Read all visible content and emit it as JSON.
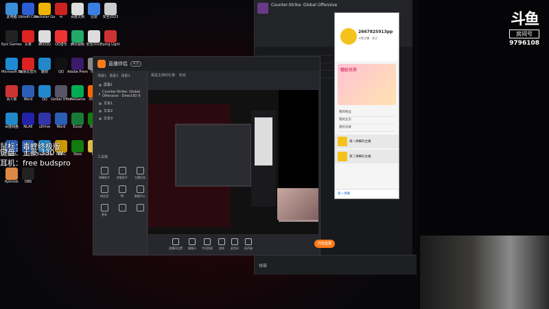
{
  "desktop": {
    "icons": [
      {
        "label": "此电脑",
        "color": "#3a8fd8"
      },
      {
        "label": "Ubisoft Connect",
        "color": "#2c5dd4"
      },
      {
        "label": "Rockstar Games",
        "color": "#f0b400"
      },
      {
        "label": "m",
        "color": "#c22"
      },
      {
        "label": "百度文档",
        "color": "#ddd"
      },
      {
        "label": "迅雷",
        "color": "#3a7fe0"
      },
      {
        "label": "安全2023",
        "color": "#ccc"
      },
      {
        "label": "Epic Games Launcher",
        "color": "#222"
      },
      {
        "label": "头条",
        "color": "#d22"
      },
      {
        "label": "腾讯QQ",
        "color": "#ddd"
      },
      {
        "label": "QQ音乐",
        "color": "#e33"
      },
      {
        "label": "腾讯视频",
        "color": "#2a6"
      },
      {
        "label": "安全2022",
        "color": "#ddd"
      },
      {
        "label": "Dying Light 2",
        "color": "#c33"
      },
      {
        "label": "Microsoft Edge",
        "color": "#1f8ad6"
      },
      {
        "label": "网易云音乐",
        "color": "#d22"
      },
      {
        "label": "酷狗",
        "color": "#28c"
      },
      {
        "label": "QQ",
        "color": "#111"
      },
      {
        "label": "Adobe Premiere",
        "color": "#3a1a6a"
      },
      {
        "label": "IMG",
        "color": "#888"
      },
      {
        "label": "Steam",
        "color": "#1a2b4a"
      },
      {
        "label": "百人斩",
        "color": "#c33"
      },
      {
        "label": "Word",
        "color": "#2a5fb5"
      },
      {
        "label": "QQ",
        "color": "#28c"
      },
      {
        "label": "Global Offensive",
        "color": "#556"
      },
      {
        "label": "WeGame",
        "color": "#0a5"
      },
      {
        "label": "Origin",
        "color": "#f60"
      },
      {
        "label": "Rockstar",
        "color": "#fa0"
      },
      {
        "label": "百度网盘",
        "color": "#28c"
      },
      {
        "label": "NLAE",
        "color": "#22a"
      },
      {
        "label": "uDrive",
        "color": "#33a"
      },
      {
        "label": "Word",
        "color": "#2a5fb5"
      },
      {
        "label": "Excel",
        "color": "#1a7a3a"
      },
      {
        "label": "Xbox",
        "color": "#107c10"
      },
      {
        "label": "WeChat",
        "color": "#0a0"
      },
      {
        "label": "Word",
        "color": "#2a5fb5"
      },
      {
        "label": "Word",
        "color": "#2a5fb5"
      },
      {
        "label": "BandiZip",
        "color": "#28c"
      },
      {
        "label": "PUBG",
        "color": "#c90"
      },
      {
        "label": "Xbox",
        "color": "#107c10"
      },
      {
        "label": "CS",
        "color": "#db4"
      },
      {
        "label": "安全",
        "color": "#ddd"
      },
      {
        "label": "Rytmisk",
        "color": "#d84"
      },
      {
        "label": "OBS",
        "color": "#222"
      }
    ],
    "overlay_lines": [
      "鼠标：毒蝰终极版",
      "键盘：土豪 330 w",
      "耳机：free budspro"
    ]
  },
  "app": {
    "title": "直播伴侣",
    "version": "4.0",
    "scene_tabs": [
      "场景1",
      "场景2",
      "场景3"
    ],
    "sources": [
      "屏幕1",
      "Counter-Strike: Global Offensive - Direct3D 9",
      "文本1",
      "文本2",
      "文本3"
    ],
    "tools_header": "工具箱",
    "tools": [
      "弹幕助手",
      "房管助手",
      "主播任务",
      "粉丝团",
      "PK",
      "数据中心",
      "更多",
      "",
      ""
    ],
    "center_tabs": [
      "我是主持的礼物",
      "粉丝"
    ],
    "bottom_bar": [
      "直播间设置",
      "摄像头",
      "手机投屏",
      "游戏",
      "麦克风",
      "扬声器"
    ],
    "start_label": "开始直播"
  },
  "chat": {
    "title": "Counter-Strike: Global Offensive",
    "input_placeholder": "弹幕"
  },
  "profile": {
    "name": "2667825913pp",
    "sub": "斗鱼主播 · 关注",
    "banner": "精彩世界",
    "list": [
      "我的粉丝",
      "我的主页",
      "通讯记录"
    ],
    "items": [
      "第一弹幕的主播",
      "第二弹幕的主播"
    ],
    "footer": "第一弹幕"
  },
  "watermark": {
    "logo": "斗鱼",
    "tag": "房间号",
    "room": "9796108"
  }
}
